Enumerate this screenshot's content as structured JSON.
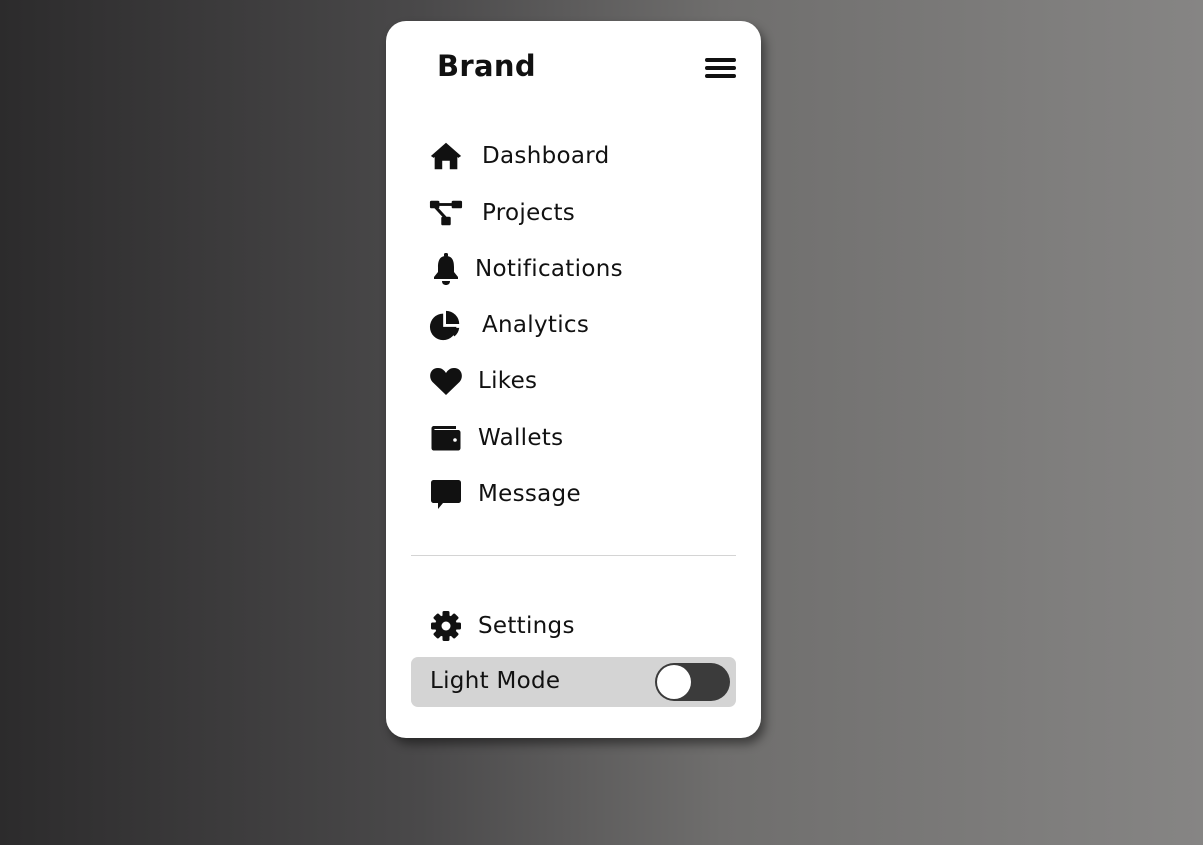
{
  "sidebar": {
    "brand": "Brand",
    "menu_icon": "hamburger-menu-icon",
    "items": [
      {
        "label": "Dashboard",
        "icon": "home-icon"
      },
      {
        "label": "Projects",
        "icon": "project-diagram-icon"
      },
      {
        "label": "Notifications",
        "icon": "bell-icon"
      },
      {
        "label": "Analytics",
        "icon": "pie-chart-icon"
      },
      {
        "label": "Likes",
        "icon": "heart-icon"
      },
      {
        "label": "Wallets",
        "icon": "wallet-icon"
      },
      {
        "label": "Message",
        "icon": "message-icon"
      }
    ],
    "settings": {
      "label": "Settings",
      "icon": "gear-icon"
    },
    "mode": {
      "label": "Light Mode",
      "toggle_on": false
    }
  },
  "colors": {
    "panel": "#ffffff",
    "text": "#111111",
    "mode_row_bg": "#d4d4d4",
    "toggle_track": "#3b3b3b",
    "toggle_knob": "#ffffff"
  }
}
